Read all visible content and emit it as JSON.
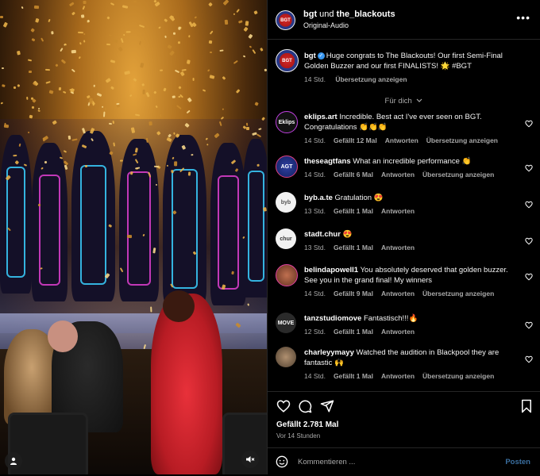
{
  "header": {
    "user1": "bgt",
    "joiner": "und",
    "user2": "the_blackouts",
    "audio": "Original-Audio",
    "more": "•••"
  },
  "caption": {
    "user": "bgt",
    "text": "Huge congrats to The Blackouts! Our first Semi-Final Golden Buzzer and our first FINALISTS! 🌟 #BGT",
    "time": "14 Std.",
    "translate": "Übersetzung anzeigen"
  },
  "for_you": "Für dich",
  "comments": [
    {
      "user": "eklips.art",
      "text": "Incredible. Best act I've ever seen on BGT. Congratulations 👏👏👏",
      "time": "14 Std.",
      "likes": "Gefällt 12 Mal",
      "reply": "Antworten",
      "translate": "Übersetzung anzeigen",
      "avatar_label": "Eklips"
    },
    {
      "user": "theseagtfans",
      "text": "What an incredible performance 👏",
      "time": "14 Std.",
      "likes": "Gefällt 6 Mal",
      "reply": "Antworten",
      "translate": "Übersetzung anzeigen",
      "avatar_label": "AGT"
    },
    {
      "user": "byb.a.te",
      "text": "Gratulation 😍",
      "time": "13 Std.",
      "likes": "Gefällt 1 Mal",
      "reply": "Antworten",
      "translate": "",
      "avatar_label": "byb"
    },
    {
      "user": "stadt.chur",
      "text": "😍",
      "time": "13 Std.",
      "likes": "Gefällt 1 Mal",
      "reply": "Antworten",
      "translate": "",
      "avatar_label": "chur"
    },
    {
      "user": "belindapowell1",
      "text": "You absolutely deserved that golden buzzer. See you in the grand final! My winners",
      "time": "14 Std.",
      "likes": "Gefällt 9 Mal",
      "reply": "Antworten",
      "translate": "Übersetzung anzeigen",
      "avatar_label": ""
    },
    {
      "user": "tanzstudiomove",
      "text": "Fantastisch!!!🔥",
      "time": "12 Std.",
      "likes": "Gefällt 1 Mal",
      "reply": "Antworten",
      "translate": "",
      "avatar_label": "MOVE"
    },
    {
      "user": "charleyymayy",
      "text": "Watched the audition in Blackpool they are fantastic 🙌",
      "time": "14 Std.",
      "likes": "Gefällt 1 Mal",
      "reply": "Antworten",
      "translate": "Übersetzung anzeigen",
      "avatar_label": ""
    }
  ],
  "actions": {
    "likes": "Gefällt 2.781 Mal",
    "posted": "Vor 14 Stunden",
    "comment_placeholder": "Kommentieren ...",
    "post_label": "Posten"
  },
  "colors": {
    "accent": "#3897f0",
    "muted_text": "#a8a8a8",
    "post_button": "#3a6fa0"
  },
  "icons": {
    "more": "more-horizontal-icon",
    "verified": "verified-badge-icon",
    "like": "heart-icon",
    "comment": "comment-icon",
    "share": "share-icon",
    "save": "bookmark-icon",
    "emoji": "emoji-icon",
    "mute": "speaker-muted-icon",
    "tags": "user-tag-icon"
  }
}
